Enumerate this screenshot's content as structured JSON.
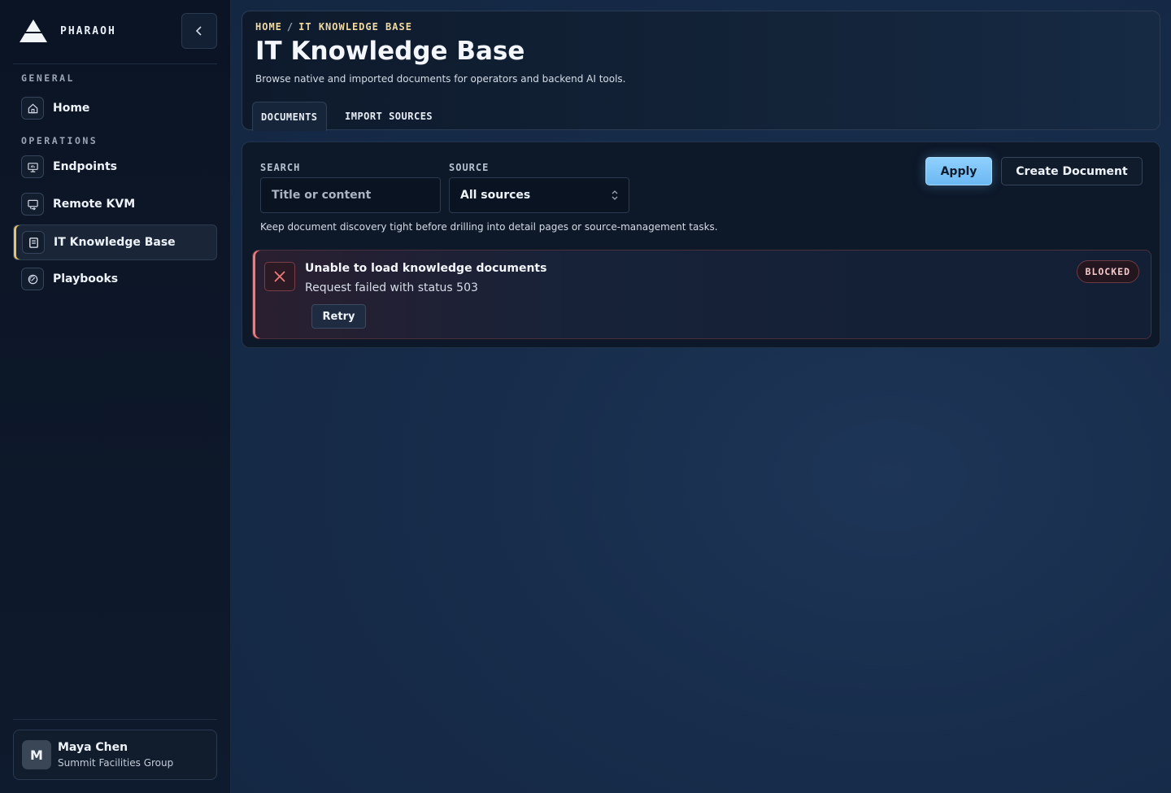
{
  "app": {
    "name": "PHARAOH"
  },
  "sidebar": {
    "sections": [
      {
        "label": "GENERAL"
      },
      {
        "label": "OPERATIONS"
      }
    ],
    "items": [
      {
        "label": "Home",
        "icon": "home-icon"
      },
      {
        "label": "Endpoints",
        "icon": "monitor-icon"
      },
      {
        "label": "Remote KVM",
        "icon": "kvm-icon"
      },
      {
        "label": "IT Knowledge Base",
        "icon": "book-icon",
        "active": true
      },
      {
        "label": "Playbooks",
        "icon": "gauge-icon"
      }
    ],
    "user": {
      "initial": "M",
      "name": "Maya Chen",
      "org": "Summit Facilities Group"
    }
  },
  "header": {
    "breadcrumb": [
      "HOME",
      "IT KNOWLEDGE BASE"
    ],
    "breadcrumb_sep": "/",
    "title": "IT Knowledge Base",
    "subtitle": "Browse native and imported documents for operators and backend AI tools.",
    "tabs": [
      {
        "label": "DOCUMENTS",
        "active": true
      },
      {
        "label": "IMPORT SOURCES",
        "active": false
      }
    ]
  },
  "filters": {
    "search_label": "SEARCH",
    "search_placeholder": "Title or content",
    "search_value": "",
    "source_label": "SOURCE",
    "source_value": "All sources",
    "apply_label": "Apply",
    "create_label": "Create Document",
    "helper": "Keep document discovery tight before drilling into detail pages or source-management tasks."
  },
  "error": {
    "title": "Unable to load knowledge documents",
    "message": "Request failed with status 503",
    "retry_label": "Retry",
    "badge": "BLOCKED"
  },
  "colors": {
    "accent": "#6bb8f2",
    "active_marker": "#e8c36a",
    "error": "#f07a7a",
    "breadcrumb": "#f0d9a0"
  }
}
